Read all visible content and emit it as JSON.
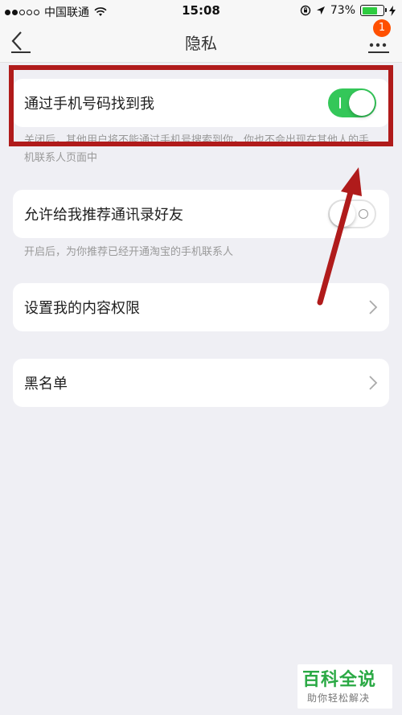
{
  "status_bar": {
    "carrier": "中国联通",
    "time": "15:08",
    "battery_percent": "73%",
    "battery_level": 0.73
  },
  "nav": {
    "title": "隐私",
    "badge_count": "1"
  },
  "settings": {
    "find_by_phone": {
      "label": "通过手机号码找到我",
      "enabled": true,
      "hint": "关闭后，其他用户将不能通过手机号搜索到你，你也不会出现在其他人的手机联系人页面中"
    },
    "recommend_contacts": {
      "label": "允许给我推荐通讯录好友",
      "enabled": false,
      "hint": "开启后，为你推荐已经开通淘宝的手机联系人"
    },
    "content_permissions": {
      "label": "设置我的内容权限"
    },
    "blacklist": {
      "label": "黑名单"
    }
  },
  "colors": {
    "toggle_on": "#34c759",
    "badge": "#ff5000",
    "annotation": "#b01b1b",
    "watermark": "#2aa944"
  },
  "watermark": {
    "title": "百科全说",
    "subtitle": "助你轻松解决"
  }
}
